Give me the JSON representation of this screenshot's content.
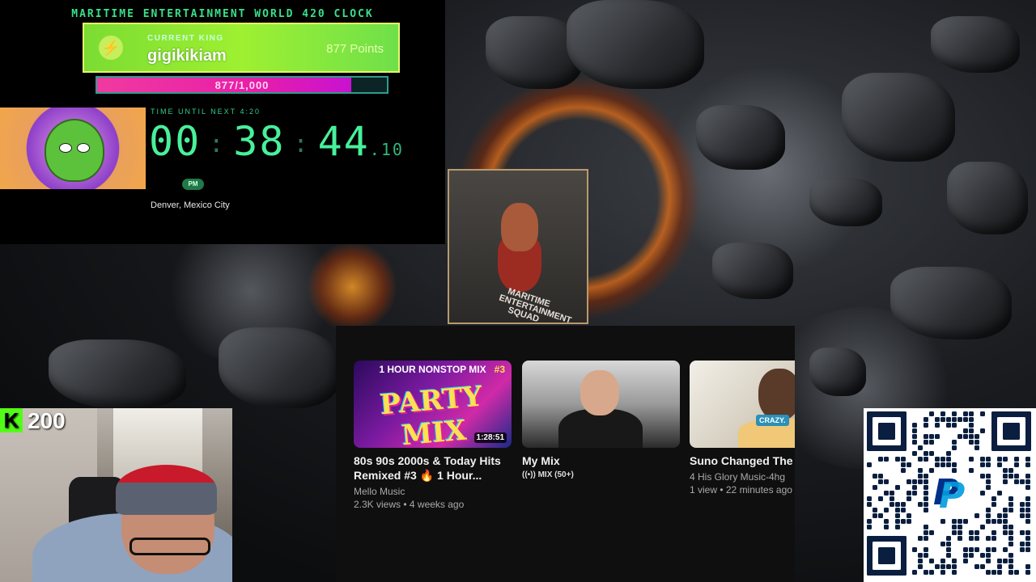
{
  "clock": {
    "title": "MARITIME ENTERTAINMENT WORLD 420 CLOCK",
    "king_label": "CURRENT KING",
    "king_name": "gigikikiam",
    "king_points": "877 Points",
    "progress_text": "877/1,000",
    "progress_fraction": 0.877,
    "time_label": "TIME UNTIL NEXT 4:20",
    "hours": "00",
    "minutes": "38",
    "seconds": "44",
    "fraction": ".10",
    "period": "PM",
    "cities": "Denver, Mexico City"
  },
  "poster": {
    "text": "MARITIME ENTERTAINMENT SQUAD"
  },
  "youtube": {
    "videos": [
      {
        "thumb_top": "1 HOUR NONSTOP MIX",
        "thumb_num": "#3",
        "thumb_main": "PARTY MIX",
        "duration": "1:28:51",
        "title_line1": "80s 90s 2000s & Today Hits",
        "title_line2": "Remixed #3 🔥 1 Hour...",
        "channel": "Mello Music",
        "meta": "2.3K views • 4 weeks ago"
      },
      {
        "title_line1": "My Mix",
        "sub": "((•)) MIX (50+)"
      },
      {
        "badge": "CRAZY.",
        "title_line1": "Suno Changed The G",
        "channel": "4 His Glory Music-4hg",
        "meta": "1 view • 22 minutes ago"
      }
    ]
  },
  "kick": {
    "logo": "K",
    "count": "200"
  },
  "qr": {
    "logo": "P"
  },
  "colors": {
    "clock_green": "#48f09a",
    "king_green": "#9ef031",
    "progress_pink": "#e81fa8",
    "kick_green": "#53fc18",
    "paypal_dark": "#003087",
    "paypal_light": "#009cde"
  }
}
